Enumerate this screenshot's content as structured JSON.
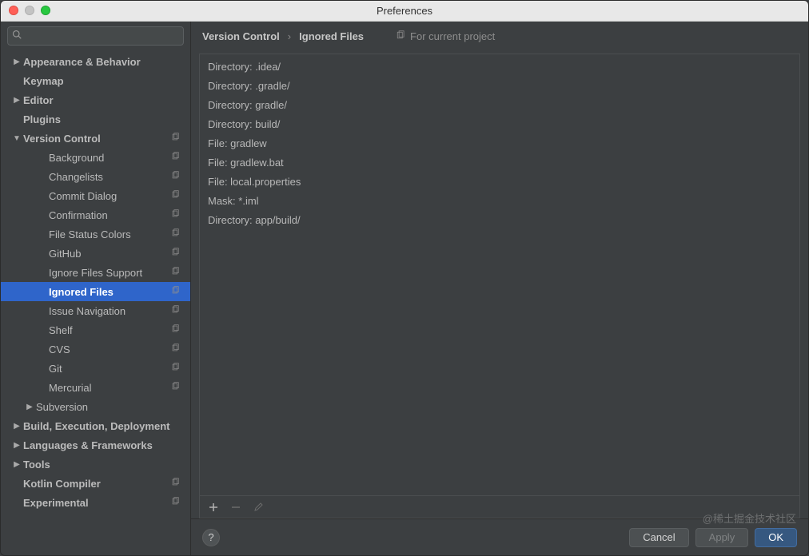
{
  "window": {
    "title": "Preferences"
  },
  "search": {
    "placeholder": ""
  },
  "breadcrumb": {
    "parent": "Version Control",
    "current": "Ignored Files",
    "hint": "For current project"
  },
  "tree": [
    {
      "label": "Appearance & Behavior",
      "arrow": "right",
      "bold": true,
      "scope": false
    },
    {
      "label": "Keymap",
      "arrow": "none",
      "bold": true,
      "scope": false
    },
    {
      "label": "Editor",
      "arrow": "right",
      "bold": true,
      "scope": false
    },
    {
      "label": "Plugins",
      "arrow": "none",
      "bold": true,
      "scope": false
    },
    {
      "label": "Version Control",
      "arrow": "down",
      "bold": true,
      "scope": true
    },
    {
      "label": "Background",
      "arrow": "none",
      "bold": false,
      "scope": true,
      "child": true
    },
    {
      "label": "Changelists",
      "arrow": "none",
      "bold": false,
      "scope": true,
      "child": true
    },
    {
      "label": "Commit Dialog",
      "arrow": "none",
      "bold": false,
      "scope": true,
      "child": true
    },
    {
      "label": "Confirmation",
      "arrow": "none",
      "bold": false,
      "scope": true,
      "child": true
    },
    {
      "label": "File Status Colors",
      "arrow": "none",
      "bold": false,
      "scope": true,
      "child": true
    },
    {
      "label": "GitHub",
      "arrow": "none",
      "bold": false,
      "scope": true,
      "child": true
    },
    {
      "label": "Ignore Files Support",
      "arrow": "none",
      "bold": false,
      "scope": true,
      "child": true
    },
    {
      "label": "Ignored Files",
      "arrow": "none",
      "bold": true,
      "scope": true,
      "child": true,
      "selected": true
    },
    {
      "label": "Issue Navigation",
      "arrow": "none",
      "bold": false,
      "scope": true,
      "child": true
    },
    {
      "label": "Shelf",
      "arrow": "none",
      "bold": false,
      "scope": true,
      "child": true
    },
    {
      "label": "CVS",
      "arrow": "none",
      "bold": false,
      "scope": true,
      "child": true
    },
    {
      "label": "Git",
      "arrow": "none",
      "bold": false,
      "scope": true,
      "child": true
    },
    {
      "label": "Mercurial",
      "arrow": "none",
      "bold": false,
      "scope": true,
      "child": true
    },
    {
      "label": "Subversion",
      "arrow": "right",
      "bold": false,
      "scope": false,
      "sub": true
    },
    {
      "label": "Build, Execution, Deployment",
      "arrow": "right",
      "bold": true,
      "scope": false
    },
    {
      "label": "Languages & Frameworks",
      "arrow": "right",
      "bold": true,
      "scope": false
    },
    {
      "label": "Tools",
      "arrow": "right",
      "bold": true,
      "scope": false
    },
    {
      "label": "Kotlin Compiler",
      "arrow": "none",
      "bold": true,
      "scope": true
    },
    {
      "label": "Experimental",
      "arrow": "none",
      "bold": true,
      "scope": true
    }
  ],
  "ignored_list": [
    "Directory: .idea/",
    "Directory: .gradle/",
    "Directory: gradle/",
    "Directory: build/",
    "File: gradlew",
    "File: gradlew.bat",
    "File: local.properties",
    "Mask: *.iml",
    "Directory: app/build/"
  ],
  "buttons": {
    "cancel": "Cancel",
    "apply": "Apply",
    "ok": "OK"
  },
  "watermark": "@稀土掘金技术社区"
}
